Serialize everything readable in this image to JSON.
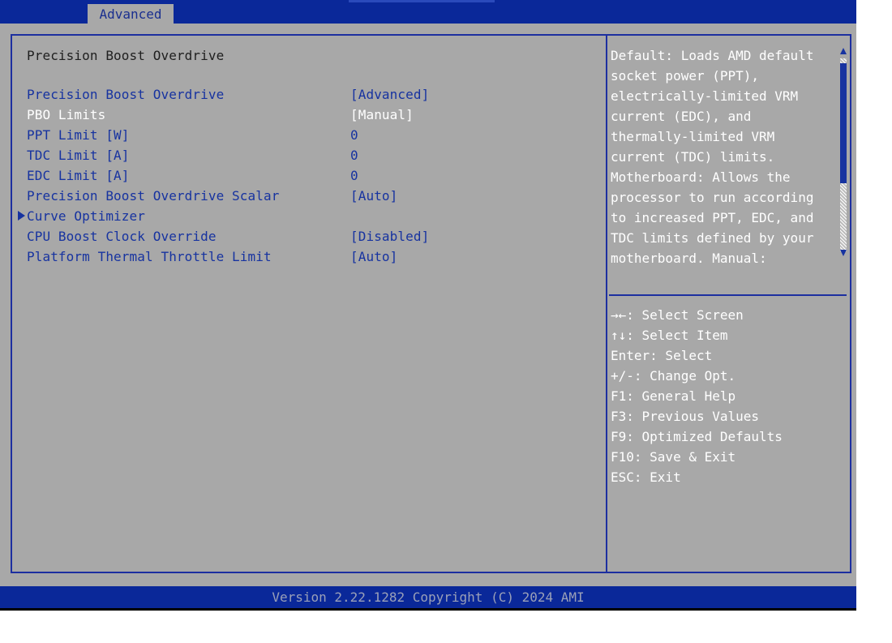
{
  "header": {
    "active_tab": "Advanced"
  },
  "section_title": "Precision Boost Overdrive",
  "settings": [
    {
      "label": "Precision Boost Overdrive",
      "value": "[Advanced]"
    },
    {
      "label": "PBO Limits",
      "value": "[Manual]",
      "selected": true
    },
    {
      "label": "PPT Limit [W]",
      "value": "0"
    },
    {
      "label": "TDC Limit [A]",
      "value": "0"
    },
    {
      "label": "EDC Limit [A]",
      "value": "0"
    },
    {
      "label": "Precision Boost Overdrive Scalar",
      "value": "[Auto]"
    },
    {
      "label": "Curve Optimizer",
      "value": "",
      "submenu": true
    },
    {
      "label": "CPU Boost Clock Override",
      "value": "[Disabled]"
    },
    {
      "label": "Platform Thermal Throttle Limit",
      "value": "[Auto]"
    }
  ],
  "help_text": [
    "Default: Loads AMD default",
    "socket power (PPT),",
    "electrically-limited VRM",
    "current (EDC), and",
    "thermally-limited VRM",
    "current (TDC) limits.",
    "Motherboard: Allows the",
    "processor to run according",
    "to increased PPT, EDC, and",
    "TDC limits defined by your",
    "motherboard. Manual:"
  ],
  "key_help": [
    "→←: Select Screen",
    "↑↓: Select Item",
    "Enter: Select",
    "+/-: Change Opt.",
    "F1: General Help",
    "F3: Previous Values",
    "F9: Optimized Defaults",
    "F10: Save & Exit",
    "ESC: Exit"
  ],
  "footer": {
    "text": "Version 2.22.1282 Copyright (C) 2024 AMI"
  },
  "icons": {
    "submenu": "triangle-right-icon",
    "scroll_up": "scroll-up-arrow-icon",
    "scroll_down": "scroll-down-arrow-icon"
  },
  "colors": {
    "accent_blue": "#0a2899",
    "panel_gray": "#a8a8a8",
    "label_blue": "#1733a0",
    "selected_white": "#ffffff"
  }
}
